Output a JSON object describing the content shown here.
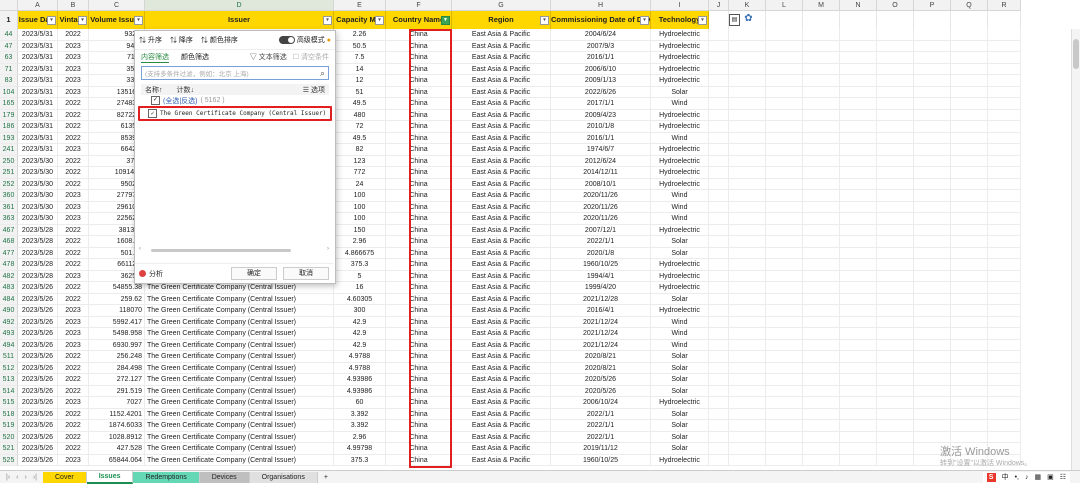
{
  "columns": [
    "A",
    "B",
    "C",
    "D",
    "E",
    "F",
    "G",
    "H",
    "I",
    "J",
    "K",
    "L",
    "M",
    "N",
    "O",
    "P",
    "Q",
    "R"
  ],
  "header_row_number": "1",
  "headers": [
    "Issue Date",
    "Vintage",
    "Volume Issued",
    "Issuer",
    "Capacity MW",
    "Country Name",
    "Region",
    "Commissioning Date of Device",
    "Technology"
  ],
  "rows": [
    [
      "44",
      "2023/5/31",
      "2022",
      "932.8",
      "",
      "2.26",
      "China",
      "East Asia & Pacific",
      "2004/6/24",
      "Hydroelectric"
    ],
    [
      "47",
      "2023/5/31",
      "2023",
      "9446",
      "",
      "50.5",
      "China",
      "East Asia & Pacific",
      "2007/9/3",
      "Hydroelectric"
    ],
    [
      "63",
      "2023/5/31",
      "2023",
      "7114",
      "",
      "7.5",
      "China",
      "East Asia & Pacific",
      "2016/1/1",
      "Hydroelectric"
    ],
    [
      "71",
      "2023/5/31",
      "2023",
      "3525",
      "",
      "14",
      "China",
      "East Asia & Pacific",
      "2006/6/10",
      "Hydroelectric"
    ],
    [
      "83",
      "2023/5/31",
      "2023",
      "3338",
      "",
      "12",
      "China",
      "East Asia & Pacific",
      "2009/1/13",
      "Hydroelectric"
    ],
    [
      "104",
      "2023/5/31",
      "2023",
      "13516.3",
      "",
      "51",
      "China",
      "East Asia & Pacific",
      "2022/6/26",
      "Solar"
    ],
    [
      "165",
      "2023/5/31",
      "2022",
      "27483.2",
      "",
      "49.5",
      "China",
      "East Asia & Pacific",
      "2017/1/1",
      "Wind"
    ],
    [
      "179",
      "2023/5/31",
      "2022",
      "827220.",
      "",
      "480",
      "China",
      "East Asia & Pacific",
      "2009/4/23",
      "Hydroelectric"
    ],
    [
      "186",
      "2023/5/31",
      "2022",
      "61350.",
      "",
      "72",
      "China",
      "East Asia & Pacific",
      "2010/1/8",
      "Hydroelectric"
    ],
    [
      "193",
      "2023/5/31",
      "2022",
      "8539.8",
      "",
      "49.5",
      "China",
      "East Asia & Pacific",
      "2016/1/1",
      "Wind"
    ],
    [
      "241",
      "2023/5/31",
      "2023",
      "6642.2",
      "",
      "82",
      "China",
      "East Asia & Pacific",
      "1974/6/7",
      "Hydroelectric"
    ],
    [
      "250",
      "2023/5/30",
      "2022",
      "3700",
      "",
      "123",
      "China",
      "East Asia & Pacific",
      "2012/6/24",
      "Hydroelectric"
    ],
    [
      "251",
      "2023/5/30",
      "2022",
      "1091463",
      "",
      "772",
      "China",
      "East Asia & Pacific",
      "2014/12/11",
      "Hydroelectric"
    ],
    [
      "252",
      "2023/5/30",
      "2022",
      "9502.8",
      "",
      "24",
      "China",
      "East Asia & Pacific",
      "2008/10/1",
      "Hydroelectric"
    ],
    [
      "360",
      "2023/5/30",
      "2023",
      "27797.5",
      "",
      "100",
      "China",
      "East Asia & Pacific",
      "2020/11/26",
      "Wind"
    ],
    [
      "361",
      "2023/5/30",
      "2023",
      "29610.7",
      "",
      "100",
      "China",
      "East Asia & Pacific",
      "2020/11/26",
      "Wind"
    ],
    [
      "363",
      "2023/5/30",
      "2023",
      "22562.9",
      "",
      "100",
      "China",
      "East Asia & Pacific",
      "2020/11/26",
      "Wind"
    ],
    [
      "467",
      "2023/5/28",
      "2022",
      "381344",
      "",
      "150",
      "China",
      "East Asia & Pacific",
      "2007/12/1",
      "Hydroelectric"
    ],
    [
      "468",
      "2023/5/28",
      "2022",
      "1608.43",
      "",
      "2.96",
      "China",
      "East Asia & Pacific",
      "2022/1/1",
      "Solar"
    ],
    [
      "477",
      "2023/5/28",
      "2022",
      "501.20",
      "",
      "4.866675",
      "China",
      "East Asia & Pacific",
      "2020/1/8",
      "Solar"
    ],
    [
      "478",
      "2023/5/28",
      "2022",
      "66112.8",
      "",
      "375.3",
      "China",
      "East Asia & Pacific",
      "1960/10/25",
      "Hydroelectric"
    ],
    [
      "482",
      "2023/5/28",
      "2023",
      "3625.9",
      "",
      "5",
      "China",
      "East Asia & Pacific",
      "1994/4/1",
      "Hydroelectric"
    ],
    [
      "483",
      "2023/5/26",
      "2022",
      "54855.38",
      "The Green Certificate Company (Central Issuer)",
      "16",
      "China",
      "East Asia & Pacific",
      "1999/4/20",
      "Hydroelectric"
    ],
    [
      "484",
      "2023/5/26",
      "2022",
      "259.62",
      "The Green Certificate Company (Central Issuer)",
      "4.60305",
      "China",
      "East Asia & Pacific",
      "2021/12/28",
      "Solar"
    ],
    [
      "490",
      "2023/5/26",
      "2023",
      "118070",
      "The Green Certificate Company (Central Issuer)",
      "300",
      "China",
      "East Asia & Pacific",
      "2016/4/1",
      "Hydroelectric"
    ],
    [
      "492",
      "2023/5/26",
      "2023",
      "5992.417",
      "The Green Certificate Company (Central Issuer)",
      "42.9",
      "China",
      "East Asia & Pacific",
      "2021/12/24",
      "Wind"
    ],
    [
      "493",
      "2023/5/26",
      "2023",
      "5498.958",
      "The Green Certificate Company (Central Issuer)",
      "42.9",
      "China",
      "East Asia & Pacific",
      "2021/12/24",
      "Wind"
    ],
    [
      "494",
      "2023/5/26",
      "2023",
      "6930.997",
      "The Green Certificate Company (Central Issuer)",
      "42.9",
      "China",
      "East Asia & Pacific",
      "2021/12/24",
      "Wind"
    ],
    [
      "511",
      "2023/5/26",
      "2022",
      "256.248",
      "The Green Certificate Company (Central Issuer)",
      "4.9788",
      "China",
      "East Asia & Pacific",
      "2020/8/21",
      "Solar"
    ],
    [
      "512",
      "2023/5/26",
      "2022",
      "284.498",
      "The Green Certificate Company (Central Issuer)",
      "4.9788",
      "China",
      "East Asia & Pacific",
      "2020/8/21",
      "Solar"
    ],
    [
      "513",
      "2023/5/26",
      "2022",
      "272.127",
      "The Green Certificate Company (Central Issuer)",
      "4.93986",
      "China",
      "East Asia & Pacific",
      "2020/5/26",
      "Solar"
    ],
    [
      "514",
      "2023/5/26",
      "2022",
      "291.519",
      "The Green Certificate Company (Central Issuer)",
      "4.93986",
      "China",
      "East Asia & Pacific",
      "2020/5/26",
      "Solar"
    ],
    [
      "515",
      "2023/5/26",
      "2023",
      "7027",
      "The Green Certificate Company (Central Issuer)",
      "60",
      "China",
      "East Asia & Pacific",
      "2006/10/24",
      "Hydroelectric"
    ],
    [
      "518",
      "2023/5/26",
      "2022",
      "1152.4201",
      "The Green Certificate Company (Central Issuer)",
      "3.392",
      "China",
      "East Asia & Pacific",
      "2022/1/1",
      "Solar"
    ],
    [
      "519",
      "2023/5/26",
      "2022",
      "1874.6033",
      "The Green Certificate Company (Central Issuer)",
      "3.392",
      "China",
      "East Asia & Pacific",
      "2022/1/1",
      "Solar"
    ],
    [
      "520",
      "2023/5/26",
      "2022",
      "1028.8912",
      "The Green Certificate Company (Central Issuer)",
      "2.96",
      "China",
      "East Asia & Pacific",
      "2022/1/1",
      "Solar"
    ],
    [
      "521",
      "2023/5/26",
      "2022",
      "427.528",
      "The Green Certificate Company (Central Issuer)",
      "4.99798",
      "China",
      "East Asia & Pacific",
      "2019/11/12",
      "Solar"
    ],
    [
      "525",
      "2023/5/26",
      "2023",
      "65844.064",
      "The Green Certificate Company (Central Issuer)",
      "375.3",
      "China",
      "East Asia & Pacific",
      "1960/10/25",
      "Hydroelectric"
    ]
  ],
  "filter_panel": {
    "sort_asc": "升序",
    "sort_desc": "降序",
    "color_sort": "颜色排序",
    "advanced_mode": "高级模式",
    "tab_content": "内容筛选",
    "tab_color": "颜色筛选",
    "text_filter": "文本筛选",
    "clear_filter": "清空条件",
    "search_placeholder": "(支持多条件过滤，例如：北京 上海)",
    "col_name": "名称↑",
    "col_count": "计数↓",
    "options": "选项",
    "select_all": "(全选|反选)",
    "select_all_count": "( 5162 )",
    "item_label": "The Green Certificate Company (Central Issuer)",
    "analyze": "分析",
    "ok": "确定",
    "cancel": "取消"
  },
  "sheet_tabs": [
    "Cover",
    "Issues",
    "Redemptions",
    "Devices",
    "Organisations"
  ],
  "add_sheet": "+",
  "ime": {
    "lang": "中"
  },
  "watermark": {
    "line1": "激活 Windows",
    "line2": "转到\"设置\"以激活 Windows。"
  }
}
